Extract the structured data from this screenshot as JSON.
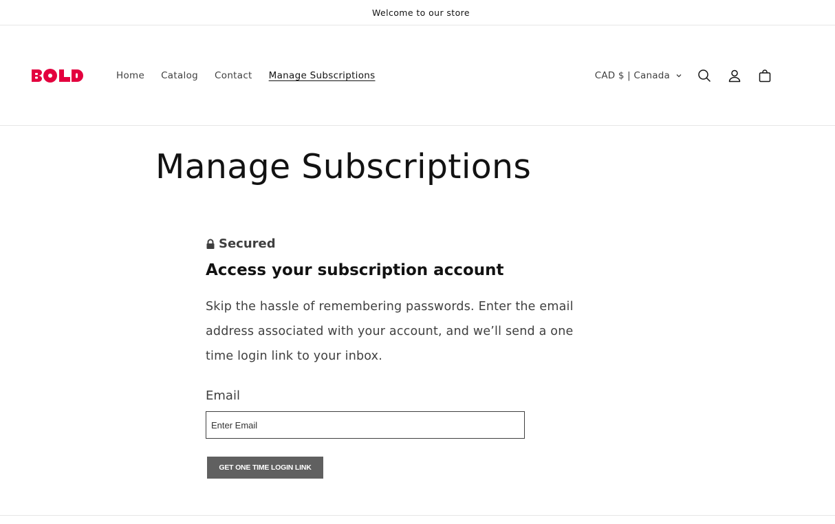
{
  "announcement": {
    "text": "Welcome to our store"
  },
  "header": {
    "logo_text": "BOLD",
    "brand_color": "#e3003e",
    "nav": [
      {
        "label": "Home"
      },
      {
        "label": "Catalog"
      },
      {
        "label": "Contact"
      },
      {
        "label": "Manage Subscriptions",
        "active": true
      }
    ],
    "currency": "CAD $ | Canada",
    "icons": [
      "search-icon",
      "account-icon",
      "cart-icon"
    ]
  },
  "main": {
    "title": "Manage Subscriptions",
    "secured_label": "Secured",
    "access_title": "Access your subscription account",
    "description": "Skip the hassle of remembering passwords. Enter the email address associated with your account, and we’ll send a one time login link to your inbox.",
    "email_label": "Email",
    "email_placeholder": "Enter Email",
    "email_value": "",
    "button_label": "GET ONE TIME LOGIN LINK"
  }
}
